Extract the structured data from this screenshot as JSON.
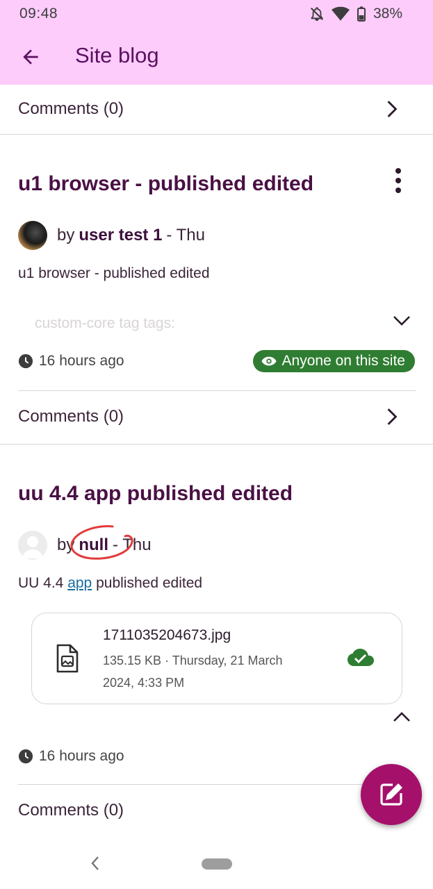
{
  "status_bar": {
    "time": "09:48",
    "battery": "38%",
    "icons": [
      "bell-off-icon",
      "wifi-icon",
      "battery-icon"
    ]
  },
  "app_bar": {
    "title": "Site blog",
    "back_icon": "arrow-back-icon"
  },
  "colors": {
    "app_bar_bg": "#fdccfb",
    "title_color": "#4a1045",
    "badge_green": "#2f7d32",
    "fab_bg": "#a4106a",
    "annotation_red": "#e23b3b"
  },
  "posts": [
    {
      "comments_label": "Comments (0)"
    },
    {
      "title": "u1 browser - published edited",
      "by_prefix": "by",
      "author": "user test 1",
      "date_suffix": "- Thu",
      "excerpt": "u1 browser - published edited",
      "tags_faded": "custom-core tag tags:",
      "time_ago": "16 hours ago",
      "visibility": "Anyone on this site",
      "comments_label": "Comments (0)"
    },
    {
      "title": "uu 4.4 app published edited",
      "by_prefix": "by",
      "author": "null",
      "date_suffix": "- Thu",
      "excerpt_before": "UU 4.4",
      "excerpt_link": "app",
      "excerpt_after": "published edited",
      "attachment": {
        "file_name": "1711035204673.jpg",
        "meta_line1": "135.15 KB · Thursday, 21 March",
        "meta_line2": "2024, 4:33 PM",
        "status_icon": "cloud-done-icon"
      },
      "time_ago": "16 hours ago",
      "comments_label": "Comments (0)"
    }
  ],
  "fab": {
    "icon": "edit-icon"
  }
}
